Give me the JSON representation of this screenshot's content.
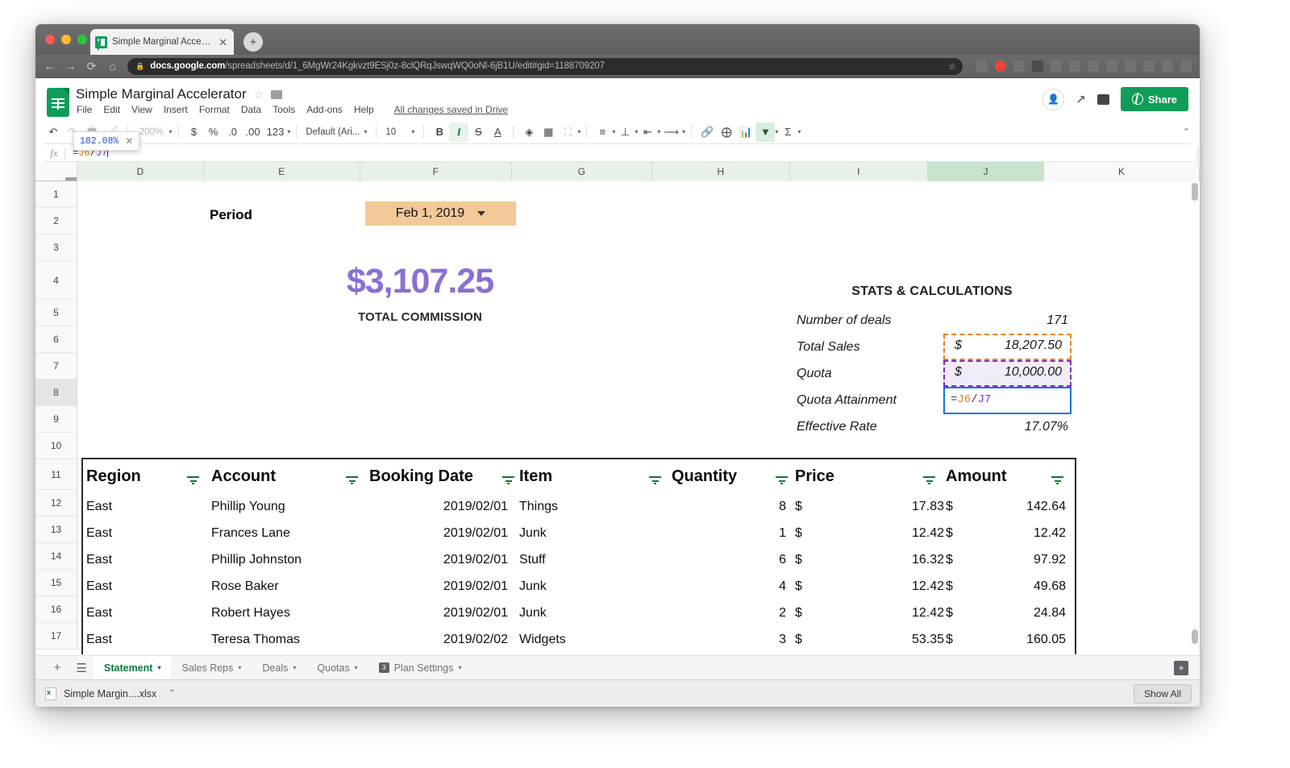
{
  "browser": {
    "tab_title": "Simple Marginal Accelerator -",
    "tab_close": "✕",
    "new_tab": "+",
    "back": "←",
    "forward": "→",
    "reload": "⟳",
    "home": "⌂",
    "lock": "🔒",
    "url_domain": "docs.google.com",
    "url_path": "/spreadsheets/d/1_6MgWr24Kgkvzt9ESj0z-8clQRqJswqWQ0oNl-6jB1U/edit#gid=1188709207",
    "star": "☆"
  },
  "docs": {
    "title": "Simple Marginal Accelerator",
    "menus": [
      "File",
      "Edit",
      "View",
      "Insert",
      "Format",
      "Data",
      "Tools",
      "Add-ons",
      "Help"
    ],
    "saved_status": "All changes saved in Drive",
    "share_label": "Share"
  },
  "toolbar": {
    "undo": "↶",
    "redo": "↷",
    "print": "🖶",
    "paint": "🖌",
    "zoom_value": "200%",
    "currency": "$",
    "percent": "%",
    "dec_less": ".0",
    "dec_more": ".00",
    "formats": "123",
    "font_name": "Default (Ari...",
    "font_size": "10",
    "bold": "B",
    "italic": "I",
    "strike": "S",
    "textcolor": "A",
    "fill": "🪣",
    "borders": "⊞",
    "merge": "⛶",
    "halign": "≡",
    "valign": "⊥",
    "wrap": "↵",
    "rotate": "⟋",
    "link": "🔗",
    "comment": "＋",
    "chart": "📊",
    "filter": "▼",
    "functions": "Σ",
    "collapse": "⌃",
    "zoom_bubble_value": "182.08%",
    "zoom_bubble_close": "✕"
  },
  "formula_bar": {
    "fx": "fx",
    "tokens": [
      {
        "t": "=",
        "c": "eq"
      },
      {
        "t": "J6",
        "c": "a"
      },
      {
        "t": "/",
        "c": "sl"
      },
      {
        "t": "J7",
        "c": "b"
      }
    ]
  },
  "grid": {
    "columns": [
      "D",
      "E",
      "F",
      "G",
      "H",
      "I",
      "J",
      "K"
    ],
    "active_column": "J",
    "rows": [
      "1",
      "2",
      "3",
      "4",
      "5",
      "6",
      "7",
      "8",
      "9",
      "10",
      "11",
      "12",
      "13",
      "14",
      "15",
      "16",
      "17"
    ],
    "active_row": "8"
  },
  "dashboard": {
    "period_label": "Period",
    "period_value": "Feb 1, 2019",
    "total_commission_value": "$3,107.25",
    "total_commission_caption": "TOTAL COMMISSION"
  },
  "stats": {
    "title": "STATS & CALCULATIONS",
    "rows": [
      {
        "label": "Number of deals",
        "currency": "",
        "value": "171"
      },
      {
        "label": "Total Sales",
        "currency": "$",
        "value": "18,207.50"
      },
      {
        "label": "Quota",
        "currency": "$",
        "value": "10,000.00"
      },
      {
        "label": "Quota Attainment",
        "currency": "",
        "value": "=J6/J7"
      },
      {
        "label": "Effective Rate",
        "currency": "",
        "value": "17.07%"
      }
    ],
    "editing_tokens": [
      {
        "t": "=",
        "c": "eq"
      },
      {
        "t": "J6",
        "c": "a"
      },
      {
        "t": "/",
        "c": "sl"
      },
      {
        "t": "J7",
        "c": "b"
      }
    ],
    "colors": {
      "total_sales_outline": "#e8821a",
      "quota_outline": "#7b2fbe",
      "active_outline": "#1a73e8",
      "commission_text": "#8a6fd6",
      "period_fill": "#f3c998"
    }
  },
  "table": {
    "headers": [
      "Region",
      "Account",
      "Booking Date",
      "Item",
      "Quantity",
      "Price",
      "Amount"
    ],
    "rows": [
      {
        "region": "East",
        "account": "Phillip Young",
        "date": "2019/02/01",
        "item": "Things",
        "qty": "8",
        "price_cur": "$",
        "price": "17.83",
        "amount_cur": "$",
        "amount": "142.64"
      },
      {
        "region": "East",
        "account": "Frances Lane",
        "date": "2019/02/01",
        "item": "Junk",
        "qty": "1",
        "price_cur": "$",
        "price": "12.42",
        "amount_cur": "$",
        "amount": "12.42"
      },
      {
        "region": "East",
        "account": "Phillip Johnston",
        "date": "2019/02/01",
        "item": "Stuff",
        "qty": "6",
        "price_cur": "$",
        "price": "16.32",
        "amount_cur": "$",
        "amount": "97.92"
      },
      {
        "region": "East",
        "account": "Rose Baker",
        "date": "2019/02/01",
        "item": "Junk",
        "qty": "4",
        "price_cur": "$",
        "price": "12.42",
        "amount_cur": "$",
        "amount": "49.68"
      },
      {
        "region": "East",
        "account": "Robert Hayes",
        "date": "2019/02/01",
        "item": "Junk",
        "qty": "2",
        "price_cur": "$",
        "price": "12.42",
        "amount_cur": "$",
        "amount": "24.84"
      },
      {
        "region": "East",
        "account": "Teresa Thomas",
        "date": "2019/02/02",
        "item": "Widgets",
        "qty": "3",
        "price_cur": "$",
        "price": "53.35",
        "amount_cur": "$",
        "amount": "160.05"
      }
    ]
  },
  "sheets": {
    "add": "+",
    "all_sheets": "☰",
    "tabs": [
      {
        "label": "Statement",
        "active": true,
        "badge": ""
      },
      {
        "label": "Sales Reps",
        "active": false,
        "badge": ""
      },
      {
        "label": "Deals",
        "active": false,
        "badge": ""
      },
      {
        "label": "Quotas",
        "active": false,
        "badge": ""
      },
      {
        "label": "Plan Settings",
        "active": false,
        "badge": "3"
      }
    ],
    "caret": "▾",
    "add_right": "+"
  },
  "downloads": {
    "file_name": "Simple Margin....xlsx",
    "file_caret": "⌃",
    "show_all": "Show All"
  }
}
